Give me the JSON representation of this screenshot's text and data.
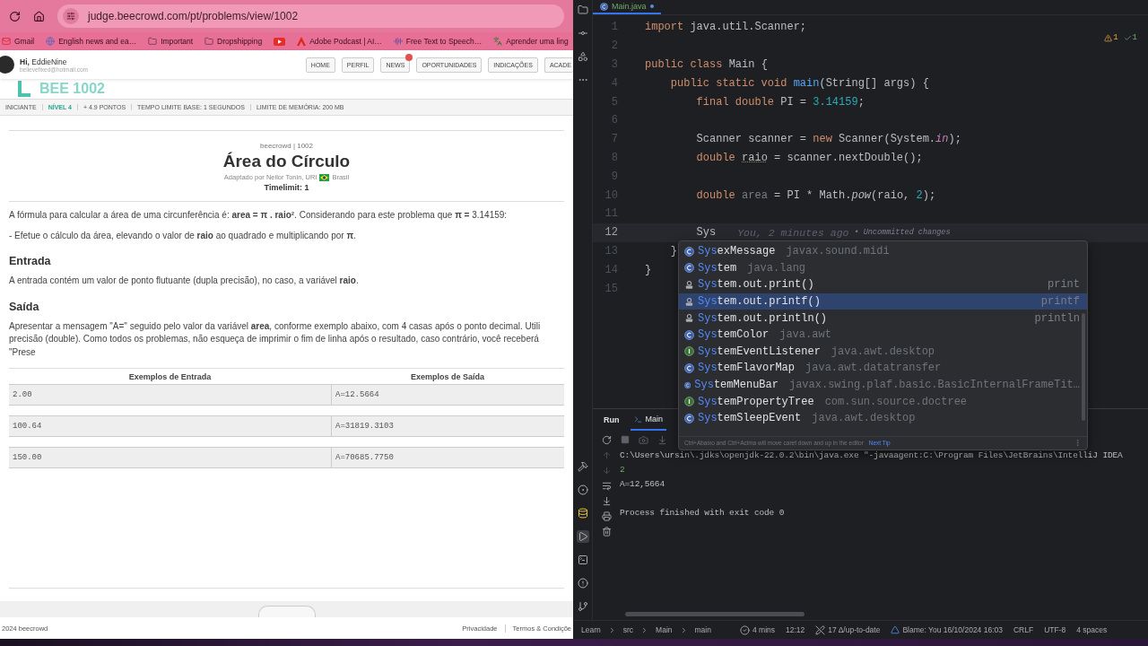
{
  "browser": {
    "url": "judge.beecrowd.com/pt/problems/view/1002",
    "bookmarks": [
      {
        "kind": "link",
        "label": "Gmail"
      },
      {
        "kind": "link",
        "label": "English news and ea…"
      },
      {
        "kind": "link",
        "label": "Important"
      },
      {
        "kind": "link",
        "label": "Dropshipping"
      },
      {
        "kind": "icon"
      },
      {
        "kind": "link",
        "label": "Adobe Podcast | AI…"
      },
      {
        "kind": "link",
        "label": "Free Text to Speech…"
      },
      {
        "kind": "link",
        "label": "Aprender uma ling"
      }
    ]
  },
  "site": {
    "greeting": "**Hi,** EddieNine",
    "email": "believefixed@hotmail.com",
    "nav": [
      {
        "label": "HOME",
        "badge": false
      },
      {
        "label": "PERFIL",
        "badge": false
      },
      {
        "label": "NEWS",
        "badge": true
      },
      {
        "label": "OPORTUNIDADES",
        "badge": false
      },
      {
        "label": "INDICAÇÕES",
        "badge": false
      },
      {
        "label": "ACADE",
        "badge": false
      }
    ],
    "logo_text": "BEE 1002",
    "info": [
      {
        "label": "INICIANTE",
        "highlight": false
      },
      {
        "label": "NÍVEL 4",
        "highlight": true
      },
      {
        "label": "+ 4.9 PONTOS",
        "highlight": false
      },
      {
        "label": "TEMPO LIMITE BASE: 1 SEGUNDOS",
        "highlight": false
      },
      {
        "label": "LIMITE DE MEMÓRIA: 200 MB",
        "highlight": false
      }
    ]
  },
  "problem": {
    "source": "beecrowd | 1002",
    "title": "Área do Círculo",
    "author": "Adaptado por Neilor Tonin, URI",
    "country": "Brasil",
    "timelimit": "Timelimit: 1",
    "intro": [
      "A fórmula para calcular a área de uma circunferência é: **area = π . raio²**. Considerando para este problema que **π =** 3.14159:",
      "- Efetue o cálculo da área, elevando o valor de **raio** ao quadrado e multiplicando por **π**."
    ],
    "sections": [
      {
        "heading": "Entrada",
        "text": "A entrada contém um valor de ponto flutuante (dupla precisão), no caso, a variável **raio**."
      },
      {
        "heading": "Saída",
        "text": "Apresentar a mensagem \"A=\" seguido pelo valor da variável **area**, conforme exemplo abaixo, com 4 casas após o ponto decimal. Utili precisão (double). Como todos os problemas, não esqueça de imprimir o fim de linha após o resultado, caso contrário, você receberá \"Prese"
      }
    ],
    "examples": {
      "columns": [
        "Exemplos de Entrada",
        "Exemplos de Saída"
      ],
      "rows": [
        [
          "2.00",
          "A=12.5664"
        ],
        [
          "100.64",
          "A=31819.3103"
        ],
        [
          "150.00",
          "A=70685.7750"
        ]
      ]
    }
  },
  "footer": {
    "copyright": "2024 beecrowd",
    "links": [
      "Privacidade",
      "Termos & Condiçõe"
    ]
  },
  "ide": {
    "tab": {
      "label": "Main.java",
      "modified": true
    },
    "inspections": [
      {
        "kind": "warning",
        "count": "1"
      },
      {
        "kind": "ok",
        "count": "1"
      }
    ],
    "lines": [
      {
        "number": "1",
        "current": false,
        "tokens": [
          {
            "kind": "keyword",
            "text": "import"
          },
          {
            "kind": "plain",
            "text": " java.util.Scanner;"
          }
        ]
      },
      {
        "number": "2",
        "current": false
      },
      {
        "number": "3",
        "current": false,
        "tokens": [
          {
            "kind": "keyword",
            "text": "public class "
          },
          {
            "kind": "plain",
            "text": "Main {"
          }
        ]
      },
      {
        "number": "4",
        "current": false,
        "tokens": [
          {
            "kind": "keyword",
            "text": "    public static void "
          },
          {
            "kind": "method",
            "text": "main"
          },
          {
            "kind": "plain",
            "text": "(String[] args) {"
          }
        ]
      },
      {
        "number": "5",
        "current": false,
        "tokens": [
          {
            "kind": "keyword",
            "text": "        final double "
          },
          {
            "kind": "plain",
            "text": "PI = "
          },
          {
            "kind": "number",
            "text": "3.14159"
          },
          {
            "kind": "plain",
            "text": ";"
          }
        ]
      },
      {
        "number": "6",
        "current": false
      },
      {
        "number": "7",
        "current": false,
        "tokens": [
          {
            "kind": "plain",
            "text": "        Scanner scanner = "
          },
          {
            "kind": "keyword",
            "text": "new "
          },
          {
            "kind": "plain",
            "text": "Scanner(System."
          },
          {
            "kind": "field",
            "text": "in"
          },
          {
            "kind": "plain",
            "text": ");"
          }
        ]
      },
      {
        "number": "8",
        "current": false,
        "tokens": [
          {
            "kind": "keyword",
            "text": "        double "
          },
          {
            "kind": "warn",
            "text": "raio"
          },
          {
            "kind": "plain",
            "text": " = scanner.nextDouble();"
          }
        ]
      },
      {
        "number": "9",
        "current": false
      },
      {
        "number": "10",
        "current": false,
        "tokens": [
          {
            "kind": "keyword",
            "text": "        double "
          },
          {
            "kind": "unused",
            "text": "area"
          },
          {
            "kind": "plain",
            "text": " = PI * Math."
          },
          {
            "kind": "italic",
            "text": "pow"
          },
          {
            "kind": "plain",
            "text": "(raio, "
          },
          {
            "kind": "number",
            "text": "2"
          },
          {
            "kind": "plain",
            "text": ");"
          }
        ]
      },
      {
        "number": "11",
        "current": false
      },
      {
        "number": "12",
        "current": true,
        "tokens": [
          {
            "kind": "plain",
            "text": "        Sys"
          }
        ],
        "blame": "You, 2 minutes ago",
        "blame_note": "• Uncommitted changes"
      },
      {
        "number": "13",
        "current": false,
        "tokens": [
          {
            "kind": "plain",
            "text": "    }"
          }
        ]
      },
      {
        "number": "14",
        "current": false,
        "tokens": [
          {
            "kind": "plain",
            "text": "}"
          }
        ]
      },
      {
        "number": "15",
        "current": false
      }
    ],
    "completion": {
      "items": [
        {
          "kind": "class",
          "match": "Sys",
          "rest": "exMessage",
          "detail": "javax.sound.midi",
          "selected": false
        },
        {
          "kind": "class",
          "match": "Sys",
          "rest": "tem",
          "detail": "java.lang",
          "selected": false
        },
        {
          "kind": "method",
          "match": "Sys",
          "rest": "tem.out.print()",
          "hint": "print",
          "selected": false
        },
        {
          "kind": "method",
          "match": "Sys",
          "rest": "tem.out.printf()",
          "hint": "printf",
          "selected": true
        },
        {
          "kind": "method",
          "match": "Sys",
          "rest": "tem.out.println()",
          "hint": "println",
          "selected": false
        },
        {
          "kind": "class",
          "match": "Sys",
          "rest": "temColor",
          "detail": "java.awt",
          "selected": false
        },
        {
          "kind": "interface",
          "match": "Sys",
          "rest": "temEventListener",
          "detail": "java.awt.desktop",
          "selected": false
        },
        {
          "kind": "class",
          "match": "Sys",
          "rest": "temFlavorMap",
          "detail": "java.awt.datatransfer",
          "selected": false
        },
        {
          "kind": "class",
          "match": "Sys",
          "rest": "temMenuBar",
          "detail": "javax.swing.plaf.basic.BasicInternalFrameTit…",
          "selected": false
        },
        {
          "kind": "interface",
          "match": "Sys",
          "rest": "temPropertyTree",
          "detail": "com.sun.source.doctree",
          "selected": false
        },
        {
          "kind": "class",
          "match": "Sys",
          "rest": "temSleepEvent",
          "detail": "java.awt.desktop",
          "selected": false
        }
      ],
      "hint": "Ctrl+Abaixo and Ctrl+Acima will move caret down and up in the editor",
      "hint_link": "Next Tip"
    },
    "run": {
      "title": "Run",
      "tabs": [
        {
          "label": "Main",
          "selected": true
        }
      ],
      "console": [
        {
          "kind": "command",
          "text": "C:\\Users\\ursin\\.jdks\\openjdk-22.0.2\\bin\\java.exe \"-javaagent:C:\\Program Files\\JetBrains\\IntelliJ IDEA"
        },
        {
          "kind": "input",
          "text": "2"
        },
        {
          "kind": "output",
          "text": "A=12,5664"
        },
        {
          "kind": "status",
          "text": "Process finished with exit code 0"
        }
      ]
    }
  },
  "status_bar": {
    "breadcrumbs": [
      "Learn",
      "src",
      "Main",
      "main"
    ],
    "items": [
      "4 mins",
      "12:12",
      "17 Δ/up-to-date",
      "Blame: You 16/10/2024 16:03",
      "CRLF",
      "UTF-8",
      "4 spaces"
    ]
  }
}
